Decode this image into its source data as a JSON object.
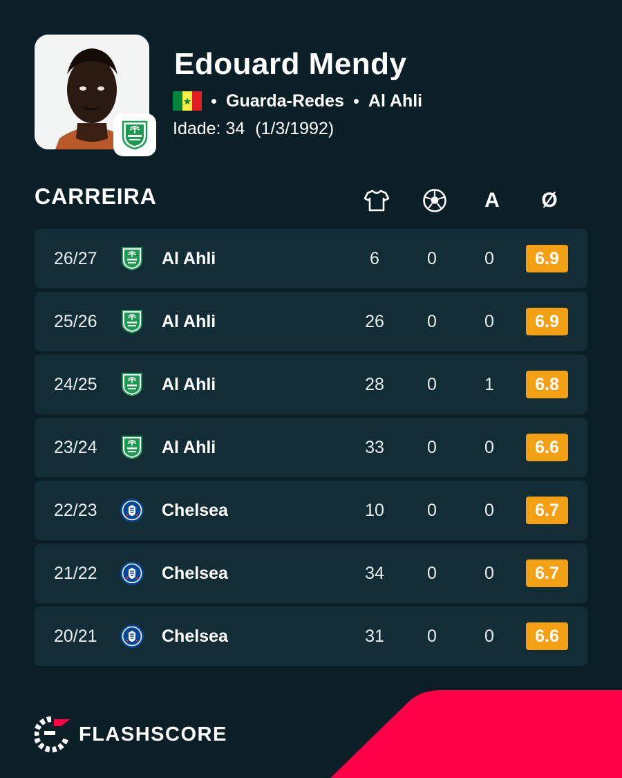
{
  "player": {
    "name": "Edouard Mendy",
    "position": "Guarda-Redes",
    "club": "Al Ahli",
    "age_label": "Idade: 34",
    "birth_date": "(1/3/1992)",
    "flag_colors": [
      "#00853f",
      "#fdef42",
      "#e31b23"
    ]
  },
  "section": {
    "title": "CARREIRA",
    "columns": [
      {
        "icon": "jersey-icon"
      },
      {
        "icon": "football-icon"
      },
      {
        "label": "A"
      },
      {
        "label": "Ø"
      }
    ]
  },
  "career": [
    {
      "season": "26/27",
      "team": "Al Ahli",
      "badge": "al-ahli-logo-icon",
      "apps": "6",
      "goals": "0",
      "assists": "0",
      "rating": "6.9"
    },
    {
      "season": "25/26",
      "team": "Al Ahli",
      "badge": "al-ahli-logo-icon",
      "apps": "26",
      "goals": "0",
      "assists": "0",
      "rating": "6.9"
    },
    {
      "season": "24/25",
      "team": "Al Ahli",
      "badge": "al-ahli-logo-icon",
      "apps": "28",
      "goals": "0",
      "assists": "1",
      "rating": "6.8"
    },
    {
      "season": "23/24",
      "team": "Al Ahli",
      "badge": "al-ahli-logo-icon",
      "apps": "33",
      "goals": "0",
      "assists": "0",
      "rating": "6.6"
    },
    {
      "season": "22/23",
      "team": "Chelsea",
      "badge": "chelsea-logo-icon",
      "apps": "10",
      "goals": "0",
      "assists": "0",
      "rating": "6.7"
    },
    {
      "season": "21/22",
      "team": "Chelsea",
      "badge": "chelsea-logo-icon",
      "apps": "34",
      "goals": "0",
      "assists": "0",
      "rating": "6.7"
    },
    {
      "season": "20/21",
      "team": "Chelsea",
      "badge": "chelsea-logo-icon",
      "apps": "31",
      "goals": "0",
      "assists": "0",
      "rating": "6.6"
    }
  ],
  "brand": {
    "name": "FLASHSCORE"
  },
  "colors": {
    "background": "#0b1f26",
    "row": "#132d36",
    "rating": "#f3a014",
    "accent": "#ff0046"
  }
}
